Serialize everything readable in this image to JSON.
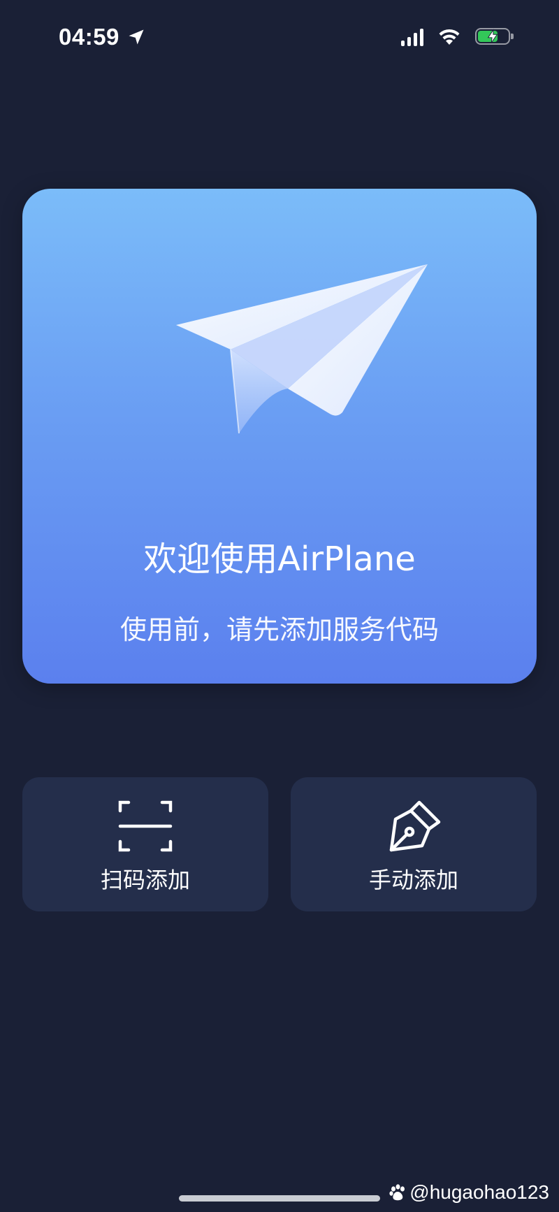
{
  "status_bar": {
    "time": "04:59",
    "icons": [
      "location-arrow-icon",
      "cellular-signal-icon",
      "wifi-icon",
      "battery-charging-icon"
    ],
    "battery_color": "#33c759"
  },
  "welcome_card": {
    "icon": "paper-plane-icon",
    "title": "欢迎使用AirPlane",
    "subtitle": "使用前，请先添加服务代码",
    "gradient_top": "#7bbcf9",
    "gradient_bottom": "#5b80ee"
  },
  "actions": [
    {
      "label": "扫码添加",
      "icon": "scan-qr-icon"
    },
    {
      "label": "手动添加",
      "icon": "pen-nib-icon"
    }
  ],
  "watermark": {
    "text": "@hugaohao123",
    "icon": "baidu-paw-icon"
  },
  "colors": {
    "background": "#1a2036",
    "button_background": "#242e4b"
  }
}
